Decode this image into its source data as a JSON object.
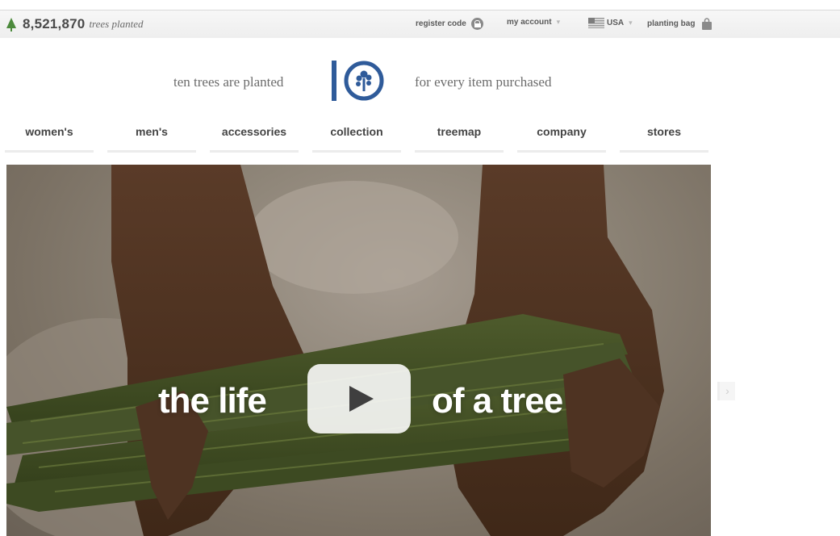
{
  "top_bar": {
    "tree_count": "8,521,870",
    "tree_count_label": "trees planted",
    "register_code": "register code",
    "my_account": "my account",
    "country": "USA",
    "planting_bag": "planting bag"
  },
  "brand": {
    "tagline_left": "ten trees are planted",
    "tagline_right": "for every item purchased",
    "logo_icon": "tentree-logo"
  },
  "nav": {
    "items": [
      "women's",
      "men's",
      "accessories",
      "collection",
      "treemap",
      "company",
      "stores"
    ]
  },
  "hero": {
    "text_left": "the life",
    "text_right": "of a tree",
    "play_icon": "play-icon"
  },
  "carousel": {
    "next_icon": "chevron-right-icon",
    "next_glyph": "›"
  },
  "colors": {
    "logo_blue": "#2f5b9a",
    "tree_green": "#4c8a3c",
    "nav_text": "#444444"
  }
}
